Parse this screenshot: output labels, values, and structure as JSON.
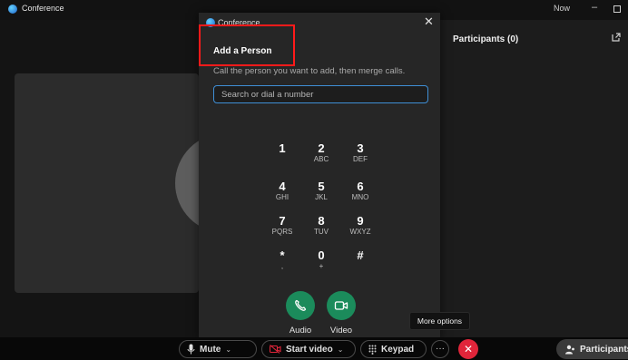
{
  "window": {
    "title": "Conference",
    "now_label": "Now",
    "minimize": "–"
  },
  "participants_panel": {
    "title": "Participants (0)"
  },
  "dialog": {
    "app_title": "Conference",
    "heading": "Add a Person",
    "instruction": "Call the person you want to add, then merge calls.",
    "search_placeholder": "Search or dial a number",
    "close": "✕",
    "keypad": [
      {
        "digit": "1",
        "letters": ""
      },
      {
        "digit": "2",
        "letters": "ABC"
      },
      {
        "digit": "3",
        "letters": "DEF"
      },
      {
        "digit": "4",
        "letters": "GHI"
      },
      {
        "digit": "5",
        "letters": "JKL"
      },
      {
        "digit": "6",
        "letters": "MNO"
      },
      {
        "digit": "7",
        "letters": "PQRS"
      },
      {
        "digit": "8",
        "letters": "TUV"
      },
      {
        "digit": "9",
        "letters": "WXYZ"
      },
      {
        "digit": "*",
        "letters": ","
      },
      {
        "digit": "0",
        "letters": "+"
      },
      {
        "digit": "#",
        "letters": ""
      }
    ],
    "audio_label": "Audio",
    "video_label": "Video"
  },
  "tooltip": {
    "text": "More options"
  },
  "controls": {
    "mute_label": "Mute",
    "start_video_label": "Start video",
    "keypad_label": "Keypad",
    "more_label": "···",
    "end_label": "✕",
    "participants_label": "Participants"
  },
  "colors": {
    "accent": "#3f8fd6",
    "call_green": "#1b8b5b",
    "end_red": "#e0253a",
    "highlight": "#ff1a1a"
  }
}
